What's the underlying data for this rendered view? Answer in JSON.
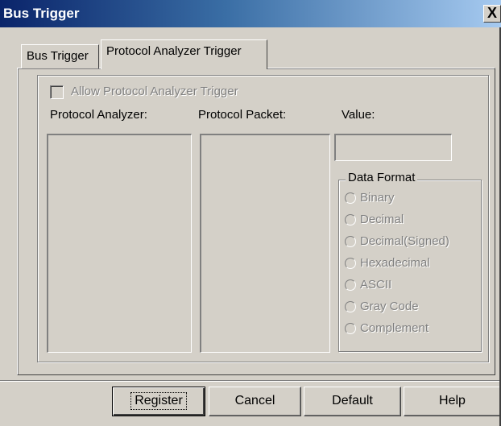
{
  "window": {
    "title": "Bus Trigger",
    "close_label": "X"
  },
  "tabs": [
    {
      "label": "Bus Trigger",
      "active": false
    },
    {
      "label": "Protocol Analyzer Trigger",
      "active": true
    }
  ],
  "trigger": {
    "allow_label": "Allow Protocol Analyzer Trigger",
    "allow_checked": false,
    "protocol_analyzer_label": "Protocol Analyzer:",
    "protocol_packet_label": "Protocol Packet:",
    "value_label": "Value:",
    "value": ""
  },
  "data_format": {
    "legend": "Data Format",
    "options": [
      "Binary",
      "Decimal",
      "Decimal(Signed)",
      "Hexadecimal",
      "ASCII",
      "Gray Code",
      "Complement"
    ]
  },
  "buttons": {
    "register": "Register",
    "cancel": "Cancel",
    "default": "Default",
    "help": "Help"
  }
}
